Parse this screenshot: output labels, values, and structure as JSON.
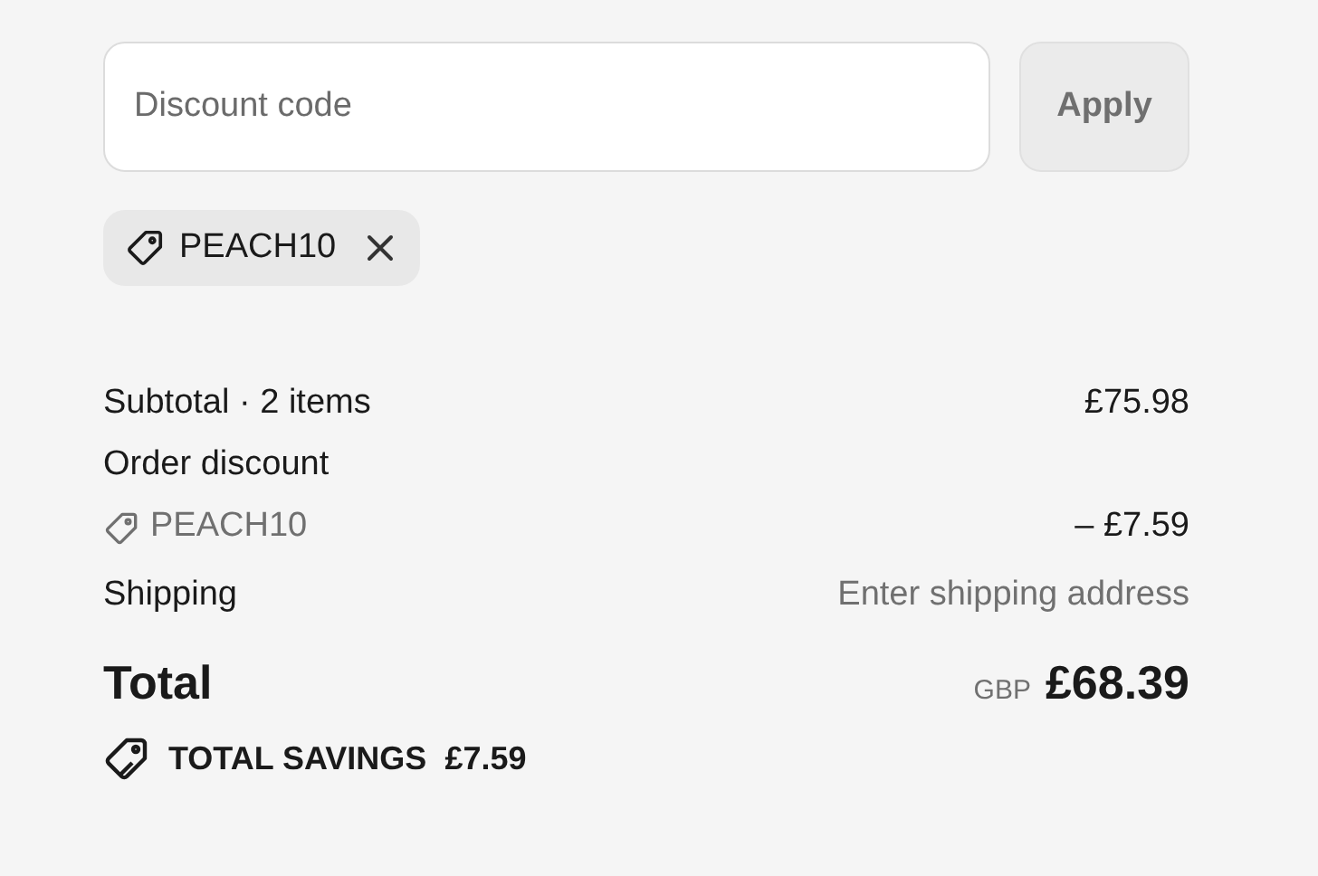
{
  "discount_field": {
    "placeholder": "Discount code"
  },
  "apply_button": {
    "label": "Apply",
    "disabled": true
  },
  "applied_codes": [
    {
      "code": "PEACH10"
    }
  ],
  "summary": {
    "subtotal": {
      "label": "Subtotal · 2 items",
      "value": "£75.98"
    },
    "order_discount": {
      "label": "Order discount",
      "code": "PEACH10",
      "value": "– £7.59"
    },
    "shipping": {
      "label": "Shipping",
      "value": "Enter shipping address"
    },
    "total": {
      "label": "Total",
      "currency": "GBP",
      "value": "£68.39"
    },
    "savings": {
      "label": "TOTAL SAVINGS",
      "value": "£7.59"
    }
  }
}
